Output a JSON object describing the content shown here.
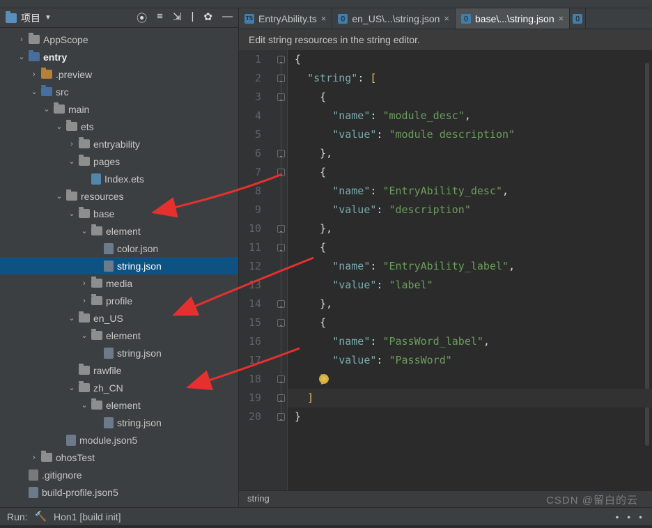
{
  "project_label": "项目",
  "toolbar_icons": [
    "target-icon",
    "stack-icon",
    "collapse-icon",
    "divider",
    "gear-icon"
  ],
  "tree": [
    {
      "indent": 1,
      "chev": ">",
      "ico": "folder",
      "label": "AppScope"
    },
    {
      "indent": 1,
      "chev": "v",
      "ico": "folder-blue",
      "label": "entry",
      "bold": true
    },
    {
      "indent": 2,
      "chev": ">",
      "ico": "folder-orange",
      "label": ".preview"
    },
    {
      "indent": 2,
      "chev": "v",
      "ico": "folder-blue",
      "label": "src"
    },
    {
      "indent": 3,
      "chev": "v",
      "ico": "folder",
      "label": "main"
    },
    {
      "indent": 4,
      "chev": "v",
      "ico": "folder",
      "label": "ets"
    },
    {
      "indent": 5,
      "chev": ">",
      "ico": "folder",
      "label": "entryability"
    },
    {
      "indent": 5,
      "chev": "v",
      "ico": "folder",
      "label": "pages"
    },
    {
      "indent": 6,
      "chev": "",
      "ico": "file-ets",
      "label": "Index.ets"
    },
    {
      "indent": 4,
      "chev": "v",
      "ico": "folder",
      "label": "resources"
    },
    {
      "indent": 5,
      "chev": "v",
      "ico": "folder",
      "label": "base"
    },
    {
      "indent": 6,
      "chev": "v",
      "ico": "folder",
      "label": "element"
    },
    {
      "indent": 7,
      "chev": "",
      "ico": "file-json",
      "label": "color.json"
    },
    {
      "indent": 7,
      "chev": "",
      "ico": "file-json",
      "label": "string.json",
      "selected": true
    },
    {
      "indent": 6,
      "chev": ">",
      "ico": "folder",
      "label": "media"
    },
    {
      "indent": 6,
      "chev": ">",
      "ico": "folder",
      "label": "profile"
    },
    {
      "indent": 5,
      "chev": "v",
      "ico": "folder",
      "label": "en_US"
    },
    {
      "indent": 6,
      "chev": "v",
      "ico": "folder",
      "label": "element"
    },
    {
      "indent": 7,
      "chev": "",
      "ico": "file-json",
      "label": "string.json"
    },
    {
      "indent": 5,
      "chev": "",
      "ico": "folder",
      "label": "rawfile"
    },
    {
      "indent": 5,
      "chev": "v",
      "ico": "folder",
      "label": "zh_CN"
    },
    {
      "indent": 6,
      "chev": "v",
      "ico": "folder",
      "label": "element"
    },
    {
      "indent": 7,
      "chev": "",
      "ico": "file-json",
      "label": "string.json"
    },
    {
      "indent": 4,
      "chev": "",
      "ico": "file-json",
      "label": "module.json5"
    },
    {
      "indent": 2,
      "chev": ">",
      "ico": "folder",
      "label": "ohosTest"
    },
    {
      "indent": 1,
      "chev": "",
      "ico": "file",
      "label": ".gitignore"
    },
    {
      "indent": 1,
      "chev": "",
      "ico": "file-json",
      "label": "build-profile.json5"
    }
  ],
  "tabs": [
    {
      "label": "EntryAbility.ts",
      "icon": "TS",
      "active": false
    },
    {
      "label": "en_US\\...\\string.json",
      "icon": "{}",
      "active": false
    },
    {
      "label": "base\\...\\string.json",
      "icon": "{}",
      "active": true
    }
  ],
  "banner": "Edit string resources in the string editor.",
  "code": {
    "lines": [
      {
        "n": 1,
        "html": "<span class='s-punc'>{</span>"
      },
      {
        "n": 2,
        "html": "  <span class='s-key'>\"string\"</span><span class='s-punc'>: </span><span class='s-br'>[</span>"
      },
      {
        "n": 3,
        "html": "    <span class='s-punc'>{</span>"
      },
      {
        "n": 4,
        "html": "      <span class='s-key'>\"name\"</span><span class='s-punc'>: </span><span class='s-str'>\"module_desc\"</span><span class='s-punc'>,</span>"
      },
      {
        "n": 5,
        "html": "      <span class='s-key'>\"value\"</span><span class='s-punc'>: </span><span class='s-str'>\"module description\"</span>"
      },
      {
        "n": 6,
        "html": "    <span class='s-punc'>},</span>"
      },
      {
        "n": 7,
        "html": "    <span class='s-punc'>{</span>"
      },
      {
        "n": 8,
        "html": "      <span class='s-key'>\"name\"</span><span class='s-punc'>: </span><span class='s-str'>\"EntryAbility_desc\"</span><span class='s-punc'>,</span>"
      },
      {
        "n": 9,
        "html": "      <span class='s-key'>\"value\"</span><span class='s-punc'>: </span><span class='s-str'>\"description\"</span>"
      },
      {
        "n": 10,
        "html": "    <span class='s-punc'>},</span>"
      },
      {
        "n": 11,
        "html": "    <span class='s-punc'>{</span>"
      },
      {
        "n": 12,
        "html": "      <span class='s-key'>\"name\"</span><span class='s-punc'>: </span><span class='s-str'>\"EntryAbility_label\"</span><span class='s-punc'>,</span>"
      },
      {
        "n": 13,
        "html": "      <span class='s-key'>\"value\"</span><span class='s-punc'>: </span><span class='s-str'>\"label\"</span>"
      },
      {
        "n": 14,
        "html": "    <span class='s-punc'>},</span>"
      },
      {
        "n": 15,
        "html": "    <span class='s-punc'>{</span>"
      },
      {
        "n": 16,
        "html": "      <span class='s-key'>\"name\"</span><span class='s-punc'>: </span><span class='s-str'>\"PassWord_label\"</span><span class='s-punc'>,</span>"
      },
      {
        "n": 17,
        "html": "      <span class='s-key'>\"value\"</span><span class='s-punc'>: </span><span class='s-str'>\"PassWord\"</span>"
      },
      {
        "n": 18,
        "html": "    <span class='s-punc'>}</span>"
      },
      {
        "n": 19,
        "html": "  <span class='s-br'>]</span>",
        "current": true
      },
      {
        "n": 20,
        "html": "<span class='s-punc'>}</span>"
      }
    ],
    "foldable": [
      0,
      1,
      2,
      5,
      6,
      9,
      10,
      13,
      14,
      17,
      18,
      19
    ]
  },
  "breadcrumb": "string",
  "run_label": "Run:",
  "run_config": "Hon1 [build init]",
  "watermark": "CSDN @留白的云"
}
